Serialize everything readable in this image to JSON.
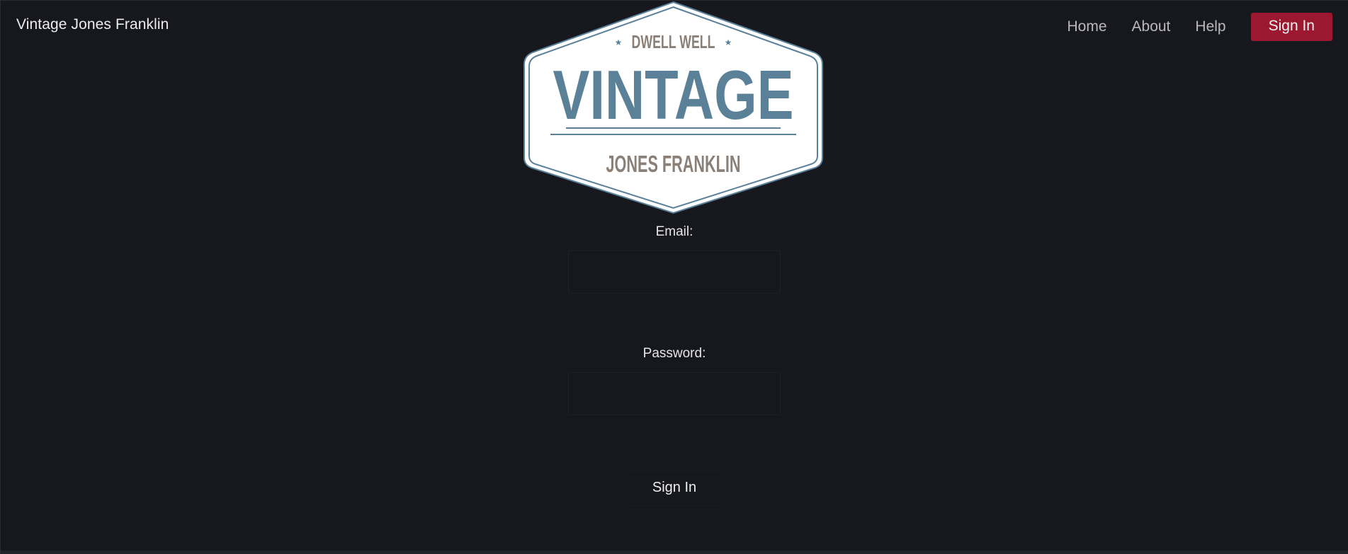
{
  "header": {
    "brand": "Vintage Jones Franklin",
    "nav": {
      "home": "Home",
      "about": "About",
      "help": "Help",
      "sign_in": "Sign In"
    }
  },
  "logo": {
    "top_text": "DWELL WELL",
    "main_text": "VINTAGE",
    "bottom_text": "JONES FRANKLIN"
  },
  "form": {
    "email_label": "Email:",
    "email_value": "",
    "password_label": "Password:",
    "password_value": "",
    "submit_label": "Sign In"
  },
  "colors": {
    "background": "#17181e",
    "accent": "#9b1830",
    "logo_blue": "#5b8199",
    "logo_taupe": "#8b8078"
  }
}
